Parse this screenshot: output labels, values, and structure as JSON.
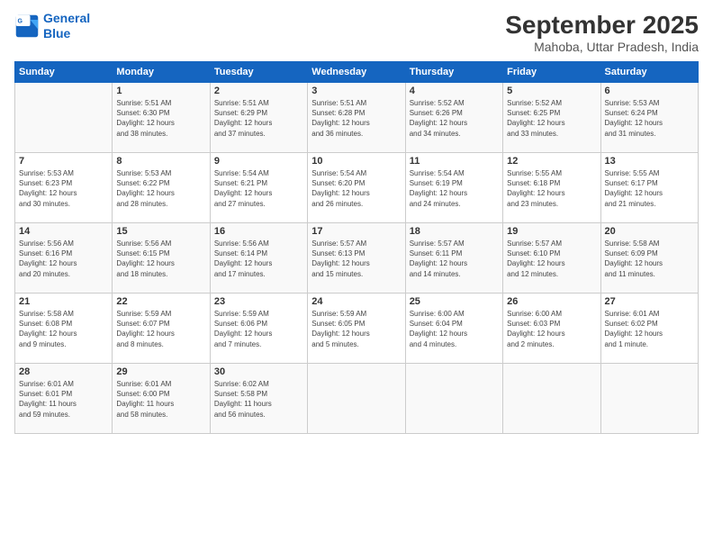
{
  "header": {
    "logo_line1": "General",
    "logo_line2": "Blue",
    "main_title": "September 2025",
    "subtitle": "Mahoba, Uttar Pradesh, India"
  },
  "days_of_week": [
    "Sunday",
    "Monday",
    "Tuesday",
    "Wednesday",
    "Thursday",
    "Friday",
    "Saturday"
  ],
  "weeks": [
    [
      {
        "day": "",
        "info": ""
      },
      {
        "day": "1",
        "info": "Sunrise: 5:51 AM\nSunset: 6:30 PM\nDaylight: 12 hours\nand 38 minutes."
      },
      {
        "day": "2",
        "info": "Sunrise: 5:51 AM\nSunset: 6:29 PM\nDaylight: 12 hours\nand 37 minutes."
      },
      {
        "day": "3",
        "info": "Sunrise: 5:51 AM\nSunset: 6:28 PM\nDaylight: 12 hours\nand 36 minutes."
      },
      {
        "day": "4",
        "info": "Sunrise: 5:52 AM\nSunset: 6:26 PM\nDaylight: 12 hours\nand 34 minutes."
      },
      {
        "day": "5",
        "info": "Sunrise: 5:52 AM\nSunset: 6:25 PM\nDaylight: 12 hours\nand 33 minutes."
      },
      {
        "day": "6",
        "info": "Sunrise: 5:53 AM\nSunset: 6:24 PM\nDaylight: 12 hours\nand 31 minutes."
      }
    ],
    [
      {
        "day": "7",
        "info": "Sunrise: 5:53 AM\nSunset: 6:23 PM\nDaylight: 12 hours\nand 30 minutes."
      },
      {
        "day": "8",
        "info": "Sunrise: 5:53 AM\nSunset: 6:22 PM\nDaylight: 12 hours\nand 28 minutes."
      },
      {
        "day": "9",
        "info": "Sunrise: 5:54 AM\nSunset: 6:21 PM\nDaylight: 12 hours\nand 27 minutes."
      },
      {
        "day": "10",
        "info": "Sunrise: 5:54 AM\nSunset: 6:20 PM\nDaylight: 12 hours\nand 26 minutes."
      },
      {
        "day": "11",
        "info": "Sunrise: 5:54 AM\nSunset: 6:19 PM\nDaylight: 12 hours\nand 24 minutes."
      },
      {
        "day": "12",
        "info": "Sunrise: 5:55 AM\nSunset: 6:18 PM\nDaylight: 12 hours\nand 23 minutes."
      },
      {
        "day": "13",
        "info": "Sunrise: 5:55 AM\nSunset: 6:17 PM\nDaylight: 12 hours\nand 21 minutes."
      }
    ],
    [
      {
        "day": "14",
        "info": "Sunrise: 5:56 AM\nSunset: 6:16 PM\nDaylight: 12 hours\nand 20 minutes."
      },
      {
        "day": "15",
        "info": "Sunrise: 5:56 AM\nSunset: 6:15 PM\nDaylight: 12 hours\nand 18 minutes."
      },
      {
        "day": "16",
        "info": "Sunrise: 5:56 AM\nSunset: 6:14 PM\nDaylight: 12 hours\nand 17 minutes."
      },
      {
        "day": "17",
        "info": "Sunrise: 5:57 AM\nSunset: 6:13 PM\nDaylight: 12 hours\nand 15 minutes."
      },
      {
        "day": "18",
        "info": "Sunrise: 5:57 AM\nSunset: 6:11 PM\nDaylight: 12 hours\nand 14 minutes."
      },
      {
        "day": "19",
        "info": "Sunrise: 5:57 AM\nSunset: 6:10 PM\nDaylight: 12 hours\nand 12 minutes."
      },
      {
        "day": "20",
        "info": "Sunrise: 5:58 AM\nSunset: 6:09 PM\nDaylight: 12 hours\nand 11 minutes."
      }
    ],
    [
      {
        "day": "21",
        "info": "Sunrise: 5:58 AM\nSunset: 6:08 PM\nDaylight: 12 hours\nand 9 minutes."
      },
      {
        "day": "22",
        "info": "Sunrise: 5:59 AM\nSunset: 6:07 PM\nDaylight: 12 hours\nand 8 minutes."
      },
      {
        "day": "23",
        "info": "Sunrise: 5:59 AM\nSunset: 6:06 PM\nDaylight: 12 hours\nand 7 minutes."
      },
      {
        "day": "24",
        "info": "Sunrise: 5:59 AM\nSunset: 6:05 PM\nDaylight: 12 hours\nand 5 minutes."
      },
      {
        "day": "25",
        "info": "Sunrise: 6:00 AM\nSunset: 6:04 PM\nDaylight: 12 hours\nand 4 minutes."
      },
      {
        "day": "26",
        "info": "Sunrise: 6:00 AM\nSunset: 6:03 PM\nDaylight: 12 hours\nand 2 minutes."
      },
      {
        "day": "27",
        "info": "Sunrise: 6:01 AM\nSunset: 6:02 PM\nDaylight: 12 hours\nand 1 minute."
      }
    ],
    [
      {
        "day": "28",
        "info": "Sunrise: 6:01 AM\nSunset: 6:01 PM\nDaylight: 11 hours\nand 59 minutes."
      },
      {
        "day": "29",
        "info": "Sunrise: 6:01 AM\nSunset: 6:00 PM\nDaylight: 11 hours\nand 58 minutes."
      },
      {
        "day": "30",
        "info": "Sunrise: 6:02 AM\nSunset: 5:58 PM\nDaylight: 11 hours\nand 56 minutes."
      },
      {
        "day": "",
        "info": ""
      },
      {
        "day": "",
        "info": ""
      },
      {
        "day": "",
        "info": ""
      },
      {
        "day": "",
        "info": ""
      }
    ]
  ]
}
